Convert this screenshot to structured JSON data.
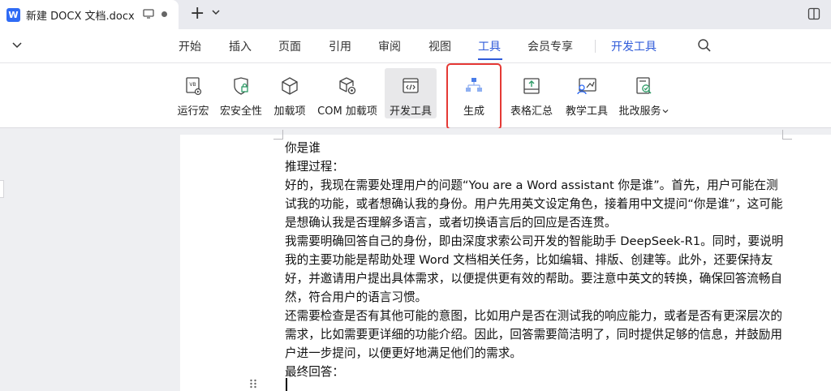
{
  "titlebar": {
    "logo_letter": "W",
    "tab_title": "新建 DOCX 文档.docx",
    "new_tab_symbol": "+"
  },
  "menu": {
    "items": [
      "开始",
      "插入",
      "页面",
      "引用",
      "审阅",
      "视图",
      "工具",
      "会员专享",
      "开发工具"
    ],
    "active": "工具"
  },
  "toolbar": {
    "items": [
      {
        "label": "运行宏",
        "icon": "vb-macro-icon"
      },
      {
        "label": "宏安全性",
        "icon": "shield-icon"
      },
      {
        "label": "加载项",
        "icon": "cube-icon"
      },
      {
        "label": "COM 加载项",
        "icon": "gear-cube-icon"
      },
      {
        "label": "开发工具",
        "icon": "code-window-icon"
      },
      {
        "label": "生成",
        "icon": "flowchart-icon"
      },
      {
        "label": "表格汇总",
        "icon": "table-summary-icon"
      },
      {
        "label": "教学工具",
        "icon": "teaching-icon"
      },
      {
        "label": "批改服务",
        "icon": "review-icon"
      }
    ]
  },
  "document": {
    "paragraphs": [
      "你是谁",
      "推理过程：",
      "好的，我现在需要处理用户的问题“You are a Word assistant 你是谁”。首先，用户可能在测试我的功能，或者想确认我的身份。用户先用英文设定角色，接着用中文提问“你是谁”，这可能是想确认我是否理解多语言，或者切换语言后的回应是否连贯。",
      "我需要明确回答自己的身份，即由深度求索公司开发的智能助手 DeepSeek-R1。同时，要说明我的主要功能是帮助处理 Word 文档相关任务，比如编辑、排版、创建等。此外，还要保持友好，并邀请用户提出具体需求，以便提供更有效的帮助。要注意中英文的转换，确保回答流畅自然，符合用户的语言习惯。",
      "还需要检查是否有其他可能的意图，比如用户是否在测试我的响应能力，或者是否有更深层次的需求，比如需要更详细的功能介绍。因此，回答需要简洁明了，同时提供足够的信息，并鼓励用户进一步提问，以便更好地满足他们的需求。",
      "最终回答："
    ]
  },
  "colors": {
    "accent": "#2f5bd9",
    "highlight": "#e53935",
    "logo": "#2f6bf5"
  }
}
